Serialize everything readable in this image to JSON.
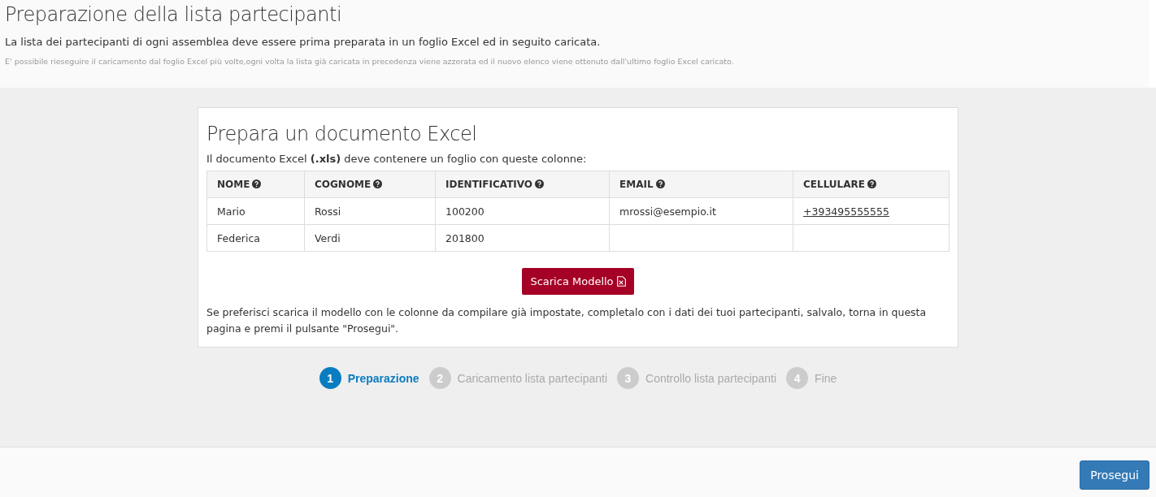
{
  "header": {
    "title": "Preparazione della lista partecipanti",
    "intro": "La lista dei partecipanti di ogni assemblea deve essere prima preparata in un foglio Excel ed in seguito caricata.",
    "note": "E' possibile rieseguire il caricamento dal foglio Excel più volte,ogni volta la lista già caricata in precedenza viene azzerata ed il nuovo elenco viene ottenuto dall'ultimo foglio Excel caricato."
  },
  "card": {
    "title": "Prepara un documento Excel",
    "description": "Il documento Excel **(.xls)** deve contenere un foglio con queste colonne:",
    "table": {
      "columns": [
        "NOME",
        "COGNOME",
        "IDENTIFICATIVO",
        "EMAIL",
        "CELLULARE"
      ],
      "rows": [
        [
          {
            "text": "Mario",
            "link": false
          },
          {
            "text": "Rossi",
            "link": false
          },
          {
            "text": "100200",
            "link": false
          },
          {
            "text": "mrossi@esempio.it",
            "link": false
          },
          {
            "text": "+393495555555",
            "link": true
          }
        ],
        [
          {
            "text": "Federica",
            "link": false
          },
          {
            "text": "Verdi",
            "link": false
          },
          {
            "text": "201800",
            "link": false
          }
        ]
      ]
    },
    "download_button": "Scarica Modello",
    "hint": "Se preferisci scarica il modello con le colonne da compilare già impostate, completalo con i dati dei tuoi partecipanti, salvalo, torna in questa pagina e premi il pulsante \"Prosegui\"."
  },
  "steps": [
    {
      "number": "1",
      "label": "Preparazione",
      "selected": true
    },
    {
      "number": "2",
      "label": "Caricamento lista partecipanti",
      "selected": false
    },
    {
      "number": "3",
      "label": "Controllo lista partecipanti",
      "selected": false
    },
    {
      "number": "4",
      "label": "Fine",
      "selected": false
    }
  ],
  "footer": {
    "button": "Prosegui"
  }
}
